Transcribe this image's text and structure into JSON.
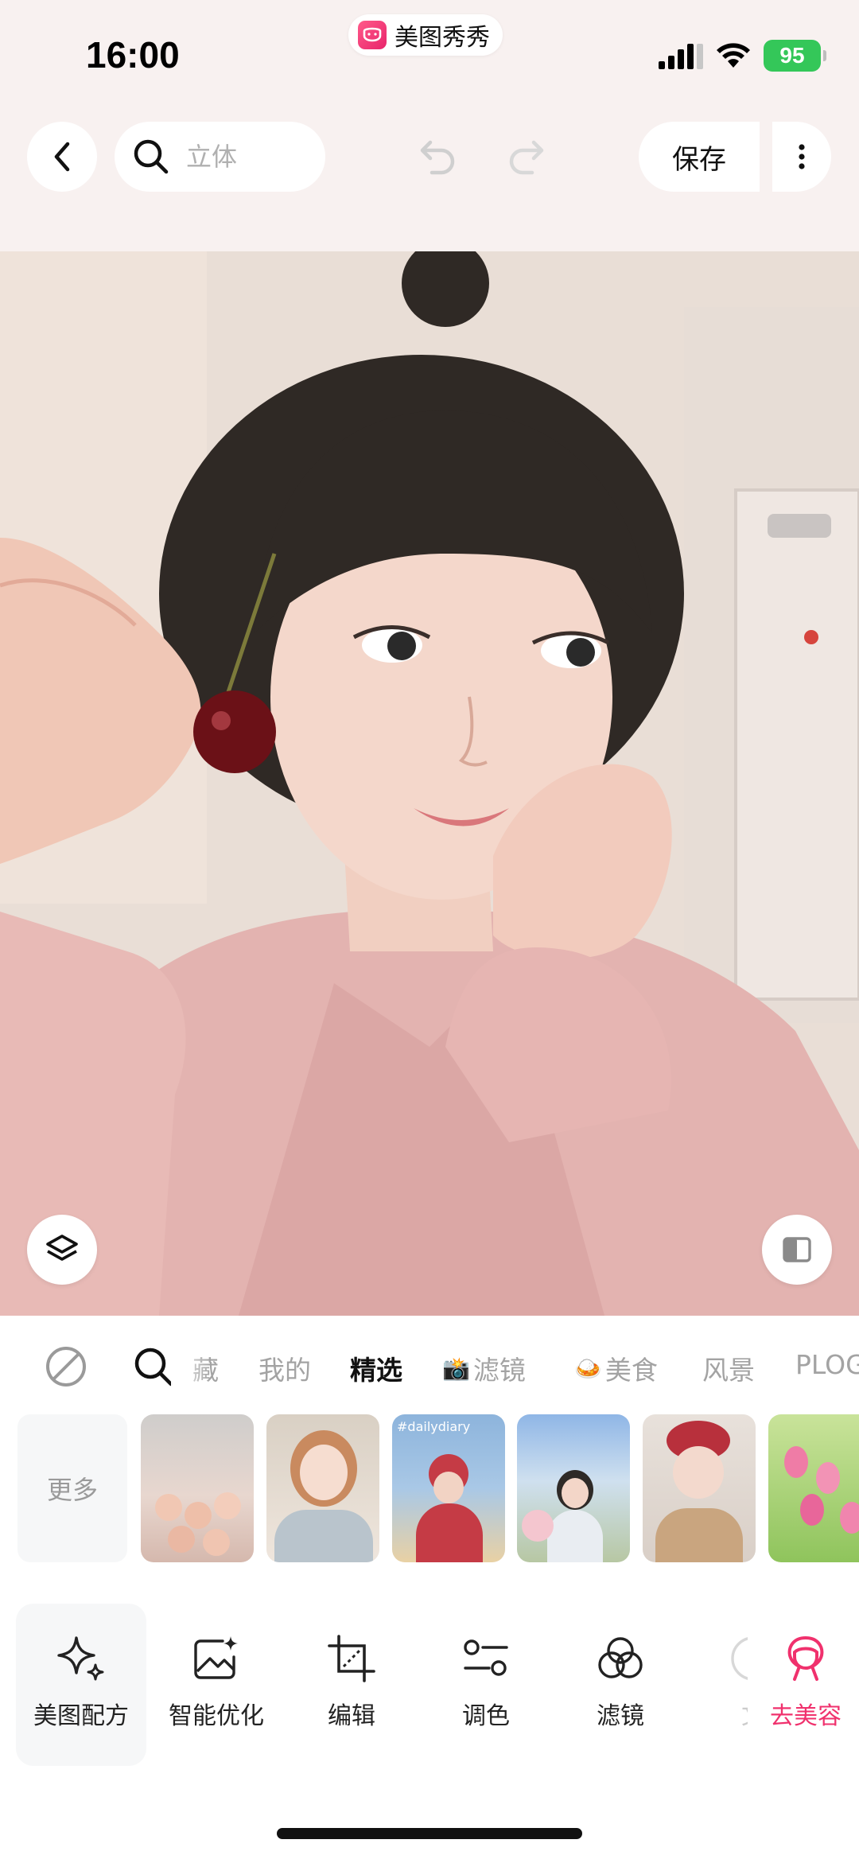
{
  "status_bar": {
    "time": "16:00",
    "app_name": "美图秀秀",
    "battery": "95"
  },
  "header": {
    "search_placeholder": "立体",
    "save_label": "保存"
  },
  "filter_tabs": [
    "藏",
    "我的",
    "精选",
    "滤镜",
    "美食",
    "风景",
    "PLOG"
  ],
  "thumbnails": {
    "more_label": "更多",
    "items": [
      "#dailydiary"
    ]
  },
  "tools": [
    {
      "label": "美图配方",
      "icon": "sparkle-icon"
    },
    {
      "label": "智能优化",
      "icon": "magic-image-icon"
    },
    {
      "label": "编辑",
      "icon": "crop-icon"
    },
    {
      "label": "调色",
      "icon": "sliders-icon"
    },
    {
      "label": "滤镜",
      "icon": "filter-circles-icon"
    },
    {
      "label": "文",
      "icon": "text-icon"
    },
    {
      "label": "去美容",
      "icon": "beauty-face-icon"
    }
  ],
  "colors": {
    "accent": "#f0316d",
    "battery": "#34c759",
    "top_background": "#f8f1f0"
  }
}
